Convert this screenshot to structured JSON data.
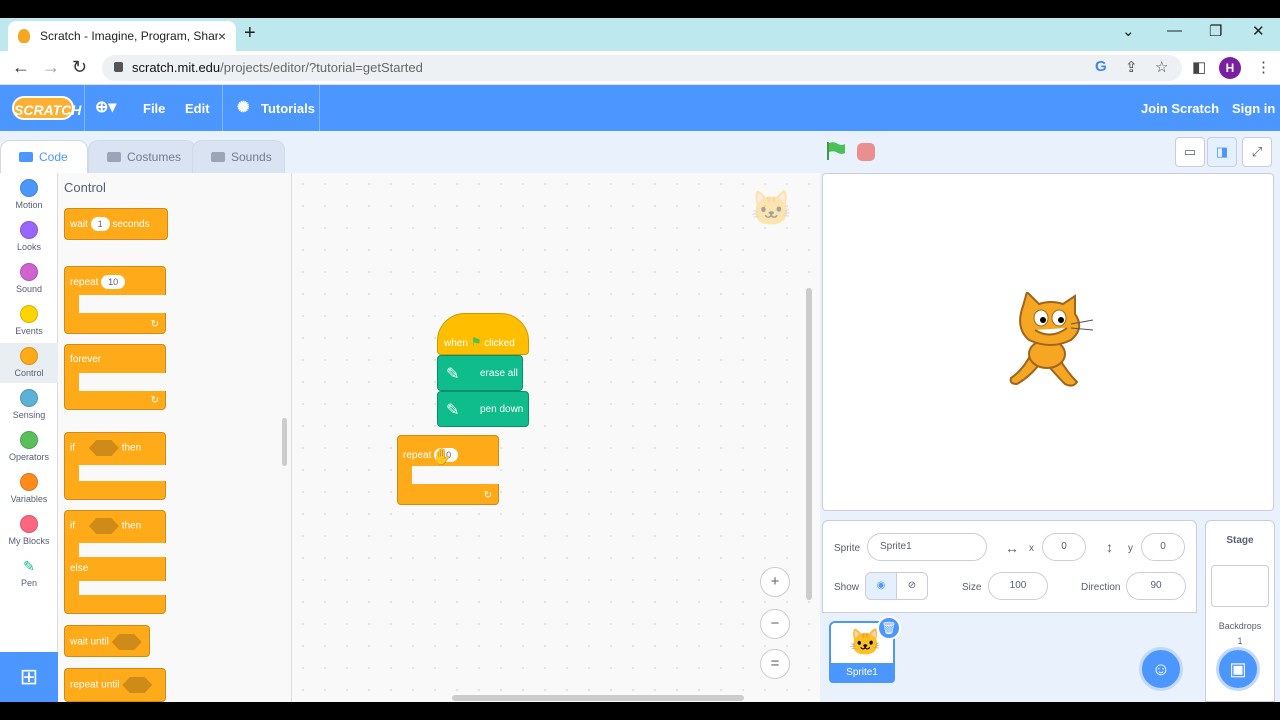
{
  "browser": {
    "tab_title": "Scratch - Imagine, Program, Shar",
    "tab_close": "×",
    "new_tab": "+",
    "url_host": "scratch.mit.edu",
    "url_path": "/projects/editor/?tutorial=getStarted",
    "profile_initial": "H"
  },
  "menu": {
    "logo": "SCRATCH",
    "file": "File",
    "edit": "Edit",
    "tutorials": "Tutorials",
    "join": "Join Scratch",
    "signin": "Sign in"
  },
  "editor_tabs": {
    "code": "Code",
    "costumes": "Costumes",
    "sounds": "Sounds"
  },
  "categories": [
    {
      "label": "Motion",
      "color": "#4c97ff"
    },
    {
      "label": "Looks",
      "color": "#9966ff"
    },
    {
      "label": "Sound",
      "color": "#cf63cf"
    },
    {
      "label": "Events",
      "color": "#ffd500"
    },
    {
      "label": "Control",
      "color": "#ffab19"
    },
    {
      "label": "Sensing",
      "color": "#5cb1d6"
    },
    {
      "label": "Operators",
      "color": "#59c059"
    },
    {
      "label": "Variables",
      "color": "#ff8c1a"
    },
    {
      "label": "My Blocks",
      "color": "#ff6680"
    },
    {
      "label": "Pen",
      "color": "#0fbd8c"
    }
  ],
  "palette": {
    "heading": "Control",
    "wait": "wait",
    "wait_value": "1",
    "seconds": "seconds",
    "repeat": "repeat",
    "repeat_value": "10",
    "forever": "forever",
    "if": "if",
    "then": "then",
    "else": "else",
    "wait_until": "wait until",
    "repeat_until": "repeat until"
  },
  "script": {
    "when": "when",
    "clicked": "clicked",
    "erase_all": "erase all",
    "pen_down": "pen down",
    "repeat": "repeat",
    "repeat_value": "10"
  },
  "zoom": {
    "in": "+",
    "out": "−",
    "reset": "="
  },
  "sprite_info": {
    "sprite_label": "Sprite",
    "sprite_name": "Sprite1",
    "x_label": "x",
    "x": "0",
    "y_label": "y",
    "y": "0",
    "show_label": "Show",
    "size_label": "Size",
    "size": "100",
    "direction_label": "Direction",
    "direction": "90"
  },
  "sprites": [
    {
      "name": "Sprite1"
    }
  ],
  "stage_panel": {
    "title": "Stage",
    "backdrops_label": "Backdrops",
    "backdrops_count": "1"
  }
}
